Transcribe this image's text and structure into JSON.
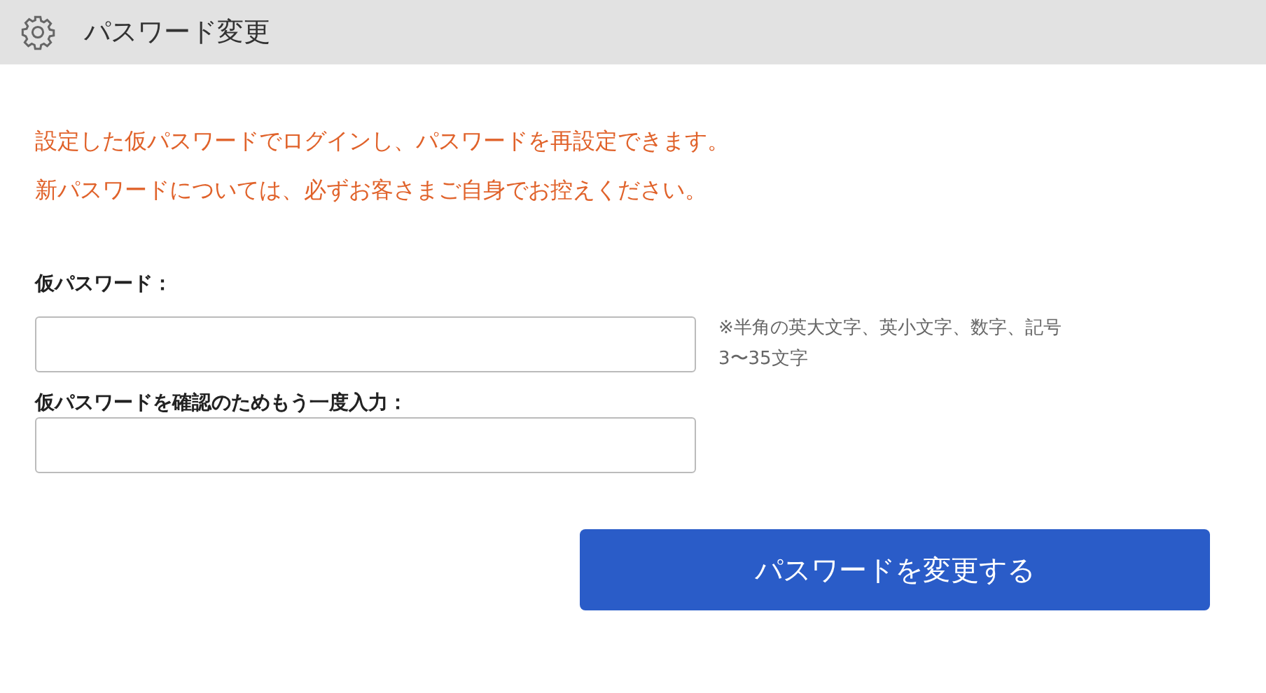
{
  "header": {
    "title": "パスワード変更"
  },
  "notice": [
    "設定した仮パスワードでログインし、パスワードを再設定できます。",
    "新パスワードについては、必ずお客さまご自身でお控えください。"
  ],
  "fields": [
    {
      "label": "仮パスワード：",
      "hint": [
        "※半角の英大文字、英小文字、数字、記号",
        "3〜35文字"
      ]
    },
    {
      "label": "仮パスワードを確認のためもう一度入力："
    }
  ],
  "submit": {
    "label": "パスワードを変更する"
  }
}
